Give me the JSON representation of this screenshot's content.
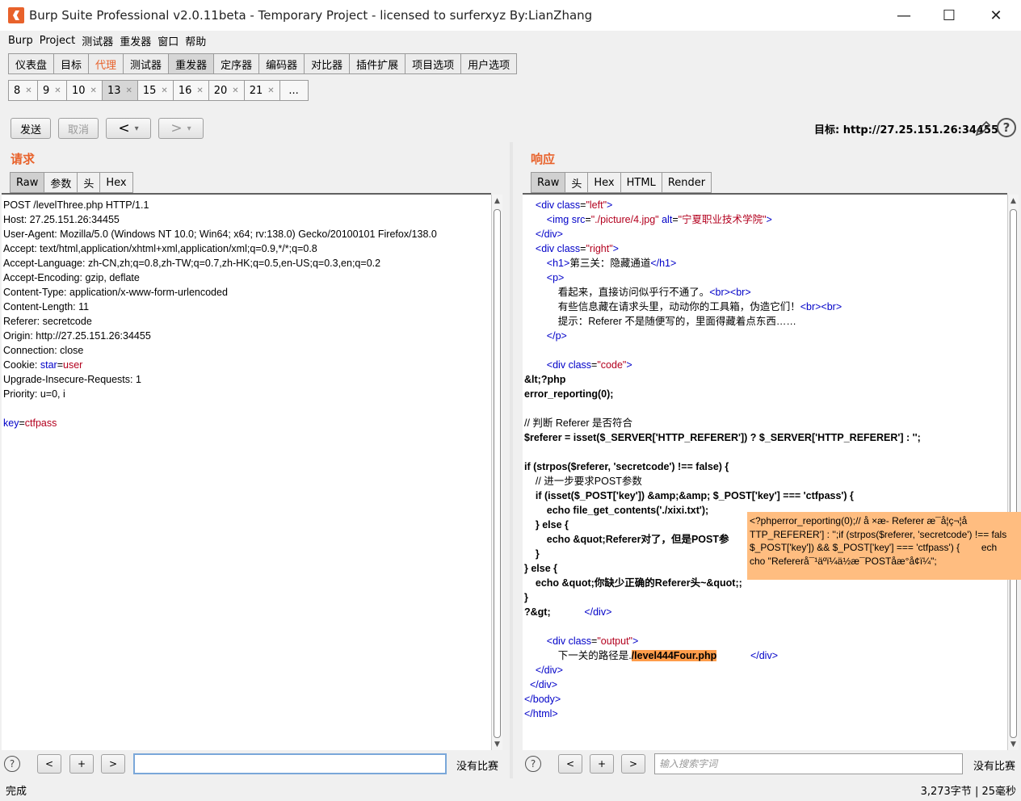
{
  "window": {
    "title": "Burp Suite Professional v2.0.11beta - Temporary Project - licensed to surferxyz By:LianZhang",
    "minimize": "—",
    "maximize": "☐",
    "close": "✕"
  },
  "menu": [
    "Burp",
    "Project",
    "测试器",
    "重发器",
    "窗口",
    "帮助"
  ],
  "main_tabs": [
    {
      "label": "仪表盘"
    },
    {
      "label": "目标"
    },
    {
      "label": "代理"
    },
    {
      "label": "测试器"
    },
    {
      "label": "重发器"
    },
    {
      "label": "定序器"
    },
    {
      "label": "编码器"
    },
    {
      "label": "对比器"
    },
    {
      "label": "插件扩展"
    },
    {
      "label": "项目选项"
    },
    {
      "label": "用户选项"
    }
  ],
  "main_tab_highlight": "代理",
  "main_tab_active": "重发器",
  "repeater_tabs": [
    "8",
    "9",
    "10",
    "13",
    "15",
    "16",
    "20",
    "21"
  ],
  "repeater_tab_more": "...",
  "repeater_tab_active": "13",
  "toolbar": {
    "send": "发送",
    "cancel": "取消",
    "back": "<",
    "forward": ">",
    "dropdown": "▾",
    "target": "目标: http://27.25.151.26:34455",
    "help": "?"
  },
  "request": {
    "title": "请求",
    "tabs": [
      "Raw",
      "参数",
      "头",
      "Hex"
    ],
    "lines": {
      "l1": "POST /levelThree.php HTTP/1.1",
      "l2": "Host: 27.25.151.26:34455",
      "l3": "User-Agent: Mozilla/5.0 (Windows NT 10.0; Win64; x64; rv:138.0) Gecko/20100101 Firefox/138.0",
      "l4": "Accept: text/html,application/xhtml+xml,application/xml;q=0.9,*/*;q=0.8",
      "l5": "Accept-Language: zh-CN,zh;q=0.8,zh-TW;q=0.7,zh-HK;q=0.5,en-US;q=0.3,en;q=0.2",
      "l6": "Accept-Encoding: gzip, deflate",
      "l7": "Content-Type: application/x-www-form-urlencoded",
      "l8": "Content-Length: 11",
      "l9": "Referer: secretcode",
      "l10": "Origin: http://27.25.151.26:34455",
      "l11": "Connection: close",
      "l12a": "Cookie: ",
      "l12b": "star",
      "l12c": "=",
      "l12d": "user",
      "l13": "Upgrade-Insecure-Requests: 1",
      "l14": "Priority: u=0, i",
      "l16a": "key",
      "l16b": "=",
      "l16c": "ctfpass"
    },
    "no_match": "没有比赛",
    "search_value": ""
  },
  "response": {
    "title": "响应",
    "tabs": [
      "Raw",
      "头",
      "Hex",
      "HTML",
      "Render"
    ],
    "lines": {
      "r1a": "<div ",
      "r1b": "class",
      "r1c": "=",
      "r1d": "\"left\"",
      "r1e": ">",
      "r2a": "<img ",
      "r2b": "src",
      "r2c": "=",
      "r2d": "\"./picture/4.jpg\"",
      "r2e": " alt",
      "r2f": "=",
      "r2g": "\"宁夏职业技术学院\"",
      "r2h": ">",
      "r3": "</div>",
      "r4a": "<div ",
      "r4b": "class",
      "r4c": "=",
      "r4d": "\"right\"",
      "r4e": ">",
      "r5a": "<h1>",
      "r5b": "第三关：隐藏通道",
      "r5c": "</h1>",
      "r6": "<p>",
      "r7a": "看起来，直接访问似乎行不通了。",
      "r7b": "<br><br>",
      "r8a": "有些信息藏在请求头里，动动你的工具箱，伪造它们！",
      "r8b": "<br><br>",
      "r9": "提示：Referer 不是随便写的，里面得藏着点东西……",
      "r10": "</p>",
      "r12a": "<div ",
      "r12b": "class",
      "r12c": "=",
      "r12d": "\"code\"",
      "r12e": ">",
      "r13": "&lt;?php",
      "r14": "error_reporting(0);",
      "r16": "// 判断 Referer 是否符合",
      "r17": "$referer = isset($_SERVER['HTTP_REFERER']) ? $_SERVER['HTTP_REFERER'] : '';",
      "r19": "if (strpos($referer, 'secretcode') !== false) {",
      "r20": "    // 进一步要求POST参数",
      "r21": "    if (isset($_POST['key']) &amp;&amp; $_POST['key'] === 'ctfpass') {",
      "r22": "        echo file_get_contents('./xixi.txt');",
      "r23": "    } else {",
      "r24": "        echo &quot;Referer对了，但是POST参",
      "r25": "    }",
      "r26": "} else {",
      "r27": "    echo &quot;你缺少正确的Referer头~&quot;;",
      "r28": "}",
      "r29a": "?&gt;",
      "r29b": "</div>",
      "r31a": "<div ",
      "r31b": "class",
      "r31c": "=",
      "r31d": "\"output\"",
      "r31e": ">",
      "r32a": "下一关的路径是.",
      "r32b": "/level444Four.php",
      "r32c": "</div>",
      "r33": "</div>",
      "r34": "</div>",
      "r35": "</body>",
      "r36": "</html>"
    },
    "tooltip": {
      "t1": "<?phperror_reporting(0);// å ×æ- Referer æ¯å¦ç¬¦å",
      "t2": "TTP_REFERER'] : '';if (strpos($referer, 'secretcode') !== fals",
      "t3": "$_POST['key']) && $_POST['key'] === 'ctfpass') {        ech",
      "t4": "cho \"Refererå¯¹äºï¼ä½æ¯POSTåæ°å¢ï¼\";"
    },
    "search_placeholder": "输入搜索字词",
    "no_match": "没有比赛"
  },
  "bottom_buttons": {
    "prev": "<",
    "add": "+",
    "next": ">",
    "help": "?"
  },
  "status": {
    "left": "完成",
    "right": "3,273字节 | 25毫秒"
  }
}
